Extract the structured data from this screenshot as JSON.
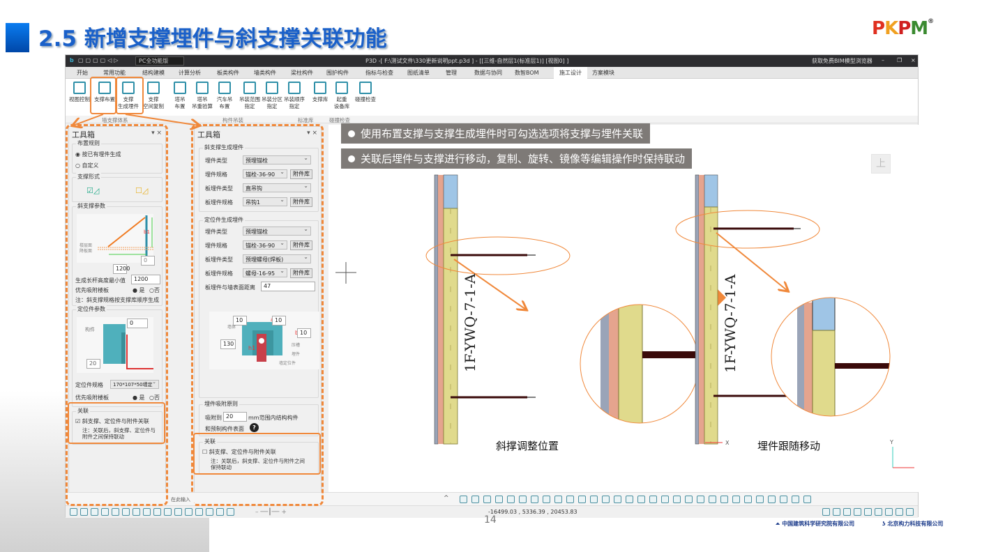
{
  "slide": {
    "title": "2.5 新增支撑埋件与斜支撑关联功能",
    "logo_text": "PKPM",
    "page_number": "14",
    "footer_logos": [
      "中国建筑科学研究院有限公司",
      "北京构力科技有限公司"
    ]
  },
  "app": {
    "title": "P3D -[ F:\\测试文件\\330更新说明ppt.p3d ] - [[三维-自然层1(标准层1)] [视图0] ]",
    "workspace": "PC全功能版",
    "get_viewer": "获取免费BIM模型浏览器",
    "menu_tabs": [
      "开始",
      "常用功能",
      "结构建模",
      "计算分析",
      "板类构件",
      "墙类构件",
      "梁柱构件",
      "围护构件",
      "指标与检查",
      "图纸清单",
      "管理",
      "数据与协同",
      "数智BOM",
      "施工设计",
      "方案模块"
    ],
    "active_tab": "施工设计",
    "ribbon_buttons": [
      {
        "label": "视图控制"
      },
      {
        "label": "支撑布置"
      },
      {
        "label": "支撑\n生成埋件"
      },
      {
        "label": "支撑\n空间复制"
      },
      {
        "label": "塔吊\n布置"
      },
      {
        "label": "塔吊\n吊重验算"
      },
      {
        "label": "汽车吊\n布置"
      },
      {
        "label": "吊装范围\n指定"
      },
      {
        "label": "吊装分区\n指定"
      },
      {
        "label": "吊装顺序\n指定"
      },
      {
        "label": "支撑库"
      },
      {
        "label": "起重\n设备库"
      },
      {
        "label": "碰撞检查"
      }
    ],
    "ribbon_groups": [
      "墙支撑体系",
      "构件吊装",
      "标准库",
      "碰撞检查"
    ],
    "command_input_placeholder": "在此输入",
    "coordinates": "-16499.03 , 5336.39 , 20453.83"
  },
  "toolbox1": {
    "title": "工具箱",
    "layout_rule": {
      "label": "布置规则",
      "options": [
        "按已有埋件生成",
        "自定义"
      ],
      "selected": "按已有埋件生成"
    },
    "support_form": {
      "label": "支撑形式",
      "checked": [
        true,
        false
      ]
    },
    "brace_params": {
      "label": "斜支撑参数",
      "diagram_labels": [
        "b1",
        "楼层面",
        "降板面"
      ],
      "dim_value": "1200",
      "offset_value": "0"
    },
    "min_height": {
      "label": "生成长杆高度最小值",
      "value": "1200"
    },
    "prefer_slab": {
      "label": "优先吸附楼板",
      "yes": "是",
      "no": "否",
      "selected": "是"
    },
    "note": "注：斜支撑规格按支撑库顺序生成",
    "locator_params": {
      "label": "定位件参数",
      "diagram_label": "构件",
      "top_value": "0",
      "bottom_value": "20"
    },
    "locator_spec": {
      "label": "定位件规格",
      "value": "170*107*50墙定位"
    },
    "prefer_slab2": {
      "label": "优先吸附楼板",
      "yes": "是",
      "no": "否",
      "selected": "是"
    },
    "association": {
      "label": "关联",
      "checkbox": "斜支撑、定位件与附件关联",
      "checked": true,
      "note": "注：关联后，斜支撑、定位件与附件之间保持联动"
    }
  },
  "toolbox2": {
    "title": "工具箱",
    "brace_embed": {
      "label": "斜支撑生成埋件",
      "rows": [
        {
          "label": "埋件类型",
          "value": "预埋锚栓"
        },
        {
          "label": "埋件规格",
          "value": "锚栓-36-90",
          "button": "附件库"
        },
        {
          "label": "板埋件类型",
          "value": "直吊钩"
        },
        {
          "label": "板埋件规格",
          "value": "吊钩1",
          "button": "附件库"
        }
      ]
    },
    "locator_embed": {
      "label": "定位件生成埋件",
      "rows": [
        {
          "label": "埋件类型",
          "value": "预埋锚栓"
        },
        {
          "label": "埋件规格",
          "value": "锚栓-36-90",
          "button": "附件库"
        },
        {
          "label": "板埋件类型",
          "value": "预埋螺母(焊板)"
        },
        {
          "label": "板埋件规格",
          "value": "螺母-16-95",
          "button": "附件库"
        }
      ],
      "distance_label": "板埋件与墙表面距离",
      "distance_value": "47"
    },
    "diagram": {
      "a1": "10",
      "a2": "10",
      "b1": "10",
      "h1": "130",
      "labels": [
        "墙体",
        "压槽",
        "埋件",
        "墙定位件"
      ],
      "dim_names": [
        "a1",
        "a2",
        "b1",
        "h1"
      ]
    },
    "adsorb": {
      "label": "埋件吸附原则",
      "prefix": "吸附到",
      "value": "20",
      "suffix": "mm范围内结构构件",
      "line2": "和预制构件表面",
      "help": "?"
    },
    "association": {
      "label": "关联",
      "checkbox": "斜支撑、定位件与附件关联",
      "checked": false,
      "note": "注：关联后，斜支撑、定位件与附件之间保持联动"
    }
  },
  "callouts": [
    "使用布置支撑与支撑生成埋件时可勾选选项将支撑与埋件关联",
    "关联后埋件与支撑进行移动，复制、旋转、镜像等编辑操作时保持联动"
  ],
  "drawing": {
    "wall_label": "1F-YWQ-7-1-A",
    "caption_before": "斜撑调整位置",
    "caption_after": "埋件跟随移动",
    "view_button": "上",
    "axis_x": "X",
    "axis_y": "Y"
  },
  "colors": {
    "accent": "#f0883a",
    "title": "#1a60c9",
    "callout_bg": "#7e7a77",
    "wall_yellow": "#e0da8c",
    "wall_pink": "#e5a48e",
    "wall_blue": "#9fc5e6",
    "brace": "#3a0a0a"
  }
}
